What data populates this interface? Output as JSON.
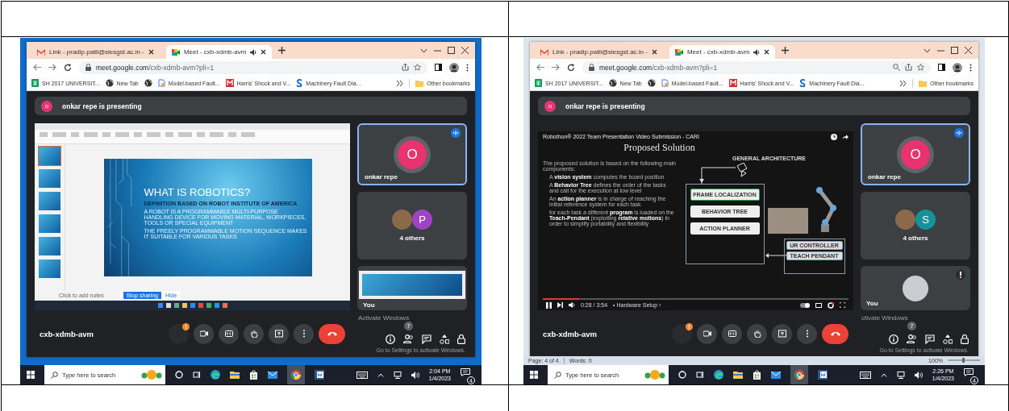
{
  "document_table": {
    "screenshots": [
      {
        "desktop": {
          "kind": "wallpaper"
        },
        "browser": {
          "tabs": [
            {
              "kind": "mail",
              "label": "Link - pradip.patil@siesgst.ac.in -",
              "selected": false
            },
            {
              "kind": "meet",
              "label": "Meet - cxb-xdmb-avm",
              "selected": true
            }
          ],
          "url_host": "meet.google.com",
          "url_path": "/cxb-xdmb-avm?pli=1",
          "zoomed": false,
          "bookmarks": [
            {
              "kind": "sheets",
              "label": "SH 2017 UNIVERSIT..."
            },
            {
              "kind": "globe",
              "label": "New Tab"
            },
            {
              "kind": "globe"
            },
            {
              "kind": "doc",
              "label": "Model-based Fault..."
            },
            {
              "kind": "m",
              "label": "Harris' Shock and V..."
            },
            {
              "kind": "s",
              "label": "Machinery Fault Dia..."
            }
          ],
          "other_bookmarks": "Other bookmarks"
        },
        "meet": {
          "banner": {
            "avatar_letter": "o",
            "text": "onkar repe is presenting"
          },
          "stage": {
            "kind": "powerpoint",
            "slide_title": "WHAT IS ROBOTICS?",
            "slide_subtitle": "DEFINITION BASED ON ROBOT INSTITUTE OF AMERICA",
            "bullets": [
              "A ROBOT IS A PROGRAMMABLE MULTI-PURPOSE HANDLING DEVICE FOR MOVING MATERIAL, WORKPIECES, TOOLS OR SPECIAL EQUIPMENT",
              "THE FREELY PROGRAMMABLE MOTION SEQUENCE MAKES IT SUITABLE FOR VARIOUS TASKS"
            ],
            "notes_placeholder": "Click to add notes",
            "stop_sharing": "Stop sharing",
            "hide": "Hide"
          },
          "tiles": [
            {
              "kind": "presenter",
              "avatar_letter": "O",
              "color": "#e8336f",
              "name": "onkar repe"
            },
            {
              "kind": "others",
              "avatar_letter": "P",
              "color": "#a142c4",
              "label": "4 others"
            },
            {
              "kind": "screen_preview",
              "name": "You"
            }
          ],
          "meeting_code": "cxb-xdmb-avm",
          "participant_count": "7"
        },
        "activation": {
          "title": "Activate Windows",
          "subtitle": "Go to Settings to activate Windows."
        },
        "taskbar": {
          "search_placeholder": "Type here to search",
          "time": "2:04 PM",
          "date": "1/4/2023",
          "notifications": "4"
        }
      },
      {
        "desktop": {
          "kind": "word_document"
        },
        "browser": {
          "tabs": [
            {
              "kind": "mail",
              "label": "Link - pradip.patil@siesgst.ac.in -",
              "selected": false
            },
            {
              "kind": "meet",
              "label": "Meet - cxb-xdmb-avm",
              "selected": true
            }
          ],
          "url_host": "meet.google.com",
          "url_path": "/cxb-xdmb-avm?pli=1",
          "zoomed": true,
          "bookmarks": [
            {
              "kind": "sheets",
              "label": "SH 2017 UNIVERSIT..."
            },
            {
              "kind": "globe",
              "label": "New Tab"
            },
            {
              "kind": "globe"
            },
            {
              "kind": "doc",
              "label": "Model-based Fault..."
            },
            {
              "kind": "m",
              "label": "Harris' Shock and V..."
            },
            {
              "kind": "s",
              "label": "Machinery Fault Dia..."
            }
          ],
          "other_bookmarks": "Other bookmarks"
        },
        "meet": {
          "banner": {
            "avatar_letter": "o",
            "text": "onkar repe is presenting"
          },
          "stage": {
            "kind": "video",
            "title": "Robothon® 2022 Team Presentation Video Submission - CARI",
            "slide_title": "Proposed Solution",
            "heading": "GENERAL ARCHITECTURE",
            "intro": "The proposed solution is based on the following main components:",
            "bullets": [
              "A **vision system** computes the board position",
              "A **Behavior Tree** defines the order of the tasks and call for the execution at low level",
              "An **action planner** is in charge of reaching the initial reference system for each task",
              "for each task a different **program** is loaded on the **Teach-Pendant** (exploiting **relative motions**) in order to simplify portability and flexibility"
            ],
            "blocks": [
              {
                "label": "FRAME LOCALIZATION",
                "highlighted": true
              },
              {
                "label": "BEHAVIOR TREE",
                "highlighted": false
              },
              {
                "label": "ACTION PLANNER",
                "highlighted": false
              }
            ],
            "robot_blocks": [
              "UR CONTROLLER",
              "TEACH PENDANT"
            ],
            "level": 0.12,
            "time": "0:28 / 3:54",
            "chapter": "• Hardware Setup ›"
          },
          "tiles": [
            {
              "kind": "presenter",
              "avatar_letter": "O",
              "color": "#e8336f",
              "name": "onkar repe"
            },
            {
              "kind": "others",
              "avatar_letter": "S",
              "color": "#12939a",
              "label": "4 others"
            },
            {
              "kind": "self",
              "name": "You"
            }
          ],
          "meeting_code": "cxb-xdmb-avm",
          "participant_count": "7"
        },
        "activation": {
          "title": "ctivate Windows",
          "subtitle": "Go to Settings to activate Windows."
        },
        "word_status": {
          "page": "Page: 4 of 4",
          "words": "Words: 0",
          "zoom": "100%"
        },
        "taskbar": {
          "search_placeholder": "Type here to search",
          "time": "2:26 PM",
          "date": "1/4/2023",
          "notifications": "4"
        }
      }
    ]
  }
}
